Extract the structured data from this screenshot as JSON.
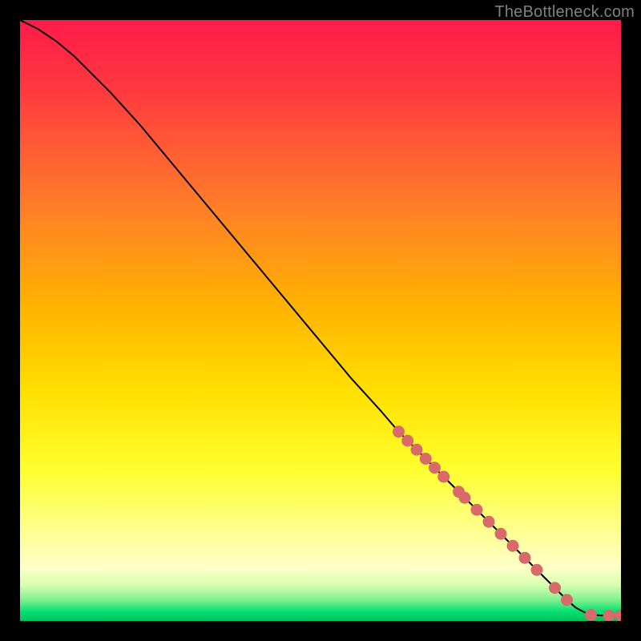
{
  "attribution": "TheBottleneck.com",
  "colors": {
    "frame": "#000000",
    "grad_top": "#ff1a4a",
    "grad_mid": "#ffd400",
    "grad_yellowpale": "#ffff80",
    "grad_green": "#00e070",
    "curve": "#000000",
    "marker_fill": "#d96a6a",
    "marker_stroke": "#b84f4f"
  },
  "chart_data": {
    "type": "line",
    "title": "",
    "xlabel": "",
    "ylabel": "",
    "xlim": [
      0,
      100
    ],
    "ylim": [
      0,
      100
    ],
    "series": [
      {
        "name": "bottleneck-curve",
        "x": [
          0,
          3,
          6,
          9,
          12,
          15,
          20,
          25,
          30,
          35,
          40,
          45,
          50,
          55,
          60,
          63,
          65,
          67,
          69,
          71,
          73,
          75,
          77,
          79,
          81,
          83,
          85,
          87,
          89,
          91,
          92.5,
          94,
          95.5,
          97,
          98.5,
          100
        ],
        "y": [
          100,
          98.5,
          96.5,
          94,
          91,
          88,
          82.5,
          76.5,
          70.5,
          64.5,
          58.5,
          52.5,
          46.5,
          40.5,
          35,
          31.5,
          29.5,
          27.5,
          25.5,
          23.5,
          21.5,
          19.5,
          17.5,
          15.5,
          13.5,
          11.5,
          9.5,
          7.5,
          5.5,
          3.5,
          2.2,
          1.4,
          1.0,
          0.9,
          0.9,
          0.9
        ]
      }
    ],
    "markers": {
      "name": "highlighted-points",
      "x": [
        63,
        64.5,
        66,
        67.5,
        69,
        70.5,
        73,
        74,
        76,
        78,
        80,
        82,
        84,
        86,
        89,
        91,
        95,
        98,
        100
      ],
      "y": [
        31.5,
        30,
        28.5,
        27,
        25.5,
        24,
        21.5,
        20.5,
        18.5,
        16.5,
        14.5,
        12.5,
        10.5,
        8.5,
        5.5,
        3.5,
        1.0,
        0.9,
        0.9
      ]
    }
  }
}
